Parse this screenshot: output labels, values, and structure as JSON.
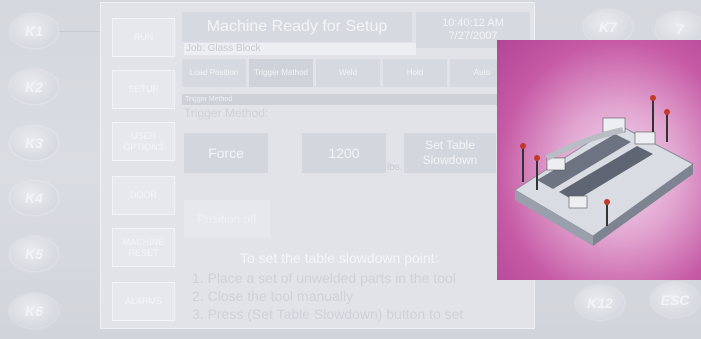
{
  "hard_keys_left": [
    "K1",
    "K2",
    "K3",
    "K4",
    "K5",
    "K6"
  ],
  "hard_keys_right": [
    "K7",
    "7",
    "K12",
    "ESC"
  ],
  "sidebar": [
    {
      "label": "RUN"
    },
    {
      "label": "SETUP"
    },
    {
      "label": "USER OPTIONS"
    },
    {
      "label": "DOOR"
    },
    {
      "label": "MACHINE RESET"
    },
    {
      "label": "ALARMS"
    }
  ],
  "header": {
    "title": "Machine Ready for Setup",
    "time": "10:40:12 AM",
    "date": "7/27/2007",
    "job": "Job: Glass Block"
  },
  "tabs": [
    {
      "label": "Load Position"
    },
    {
      "label": "Trigger Method"
    },
    {
      "label": "Weld"
    },
    {
      "label": "Hold"
    },
    {
      "label": "Auto"
    }
  ],
  "section": {
    "header": "Trigger Method",
    "subtitle": "Trigger Method:",
    "force_label": "Force",
    "force_value": "1200",
    "force_unit": "lbs.",
    "slowdown_label": "Set Table Slowdown",
    "position_label": "Position off"
  },
  "instructions": {
    "title": "To set  the table slowdown point:",
    "steps": [
      "1. Place a set of unwelded parts in the tool",
      "2. Close the tool manually",
      "3. Press (Set Table Slowdown) button to set"
    ]
  },
  "colors": {
    "photo_bg": "#c65aa5",
    "panel": "#e1e3e9"
  }
}
